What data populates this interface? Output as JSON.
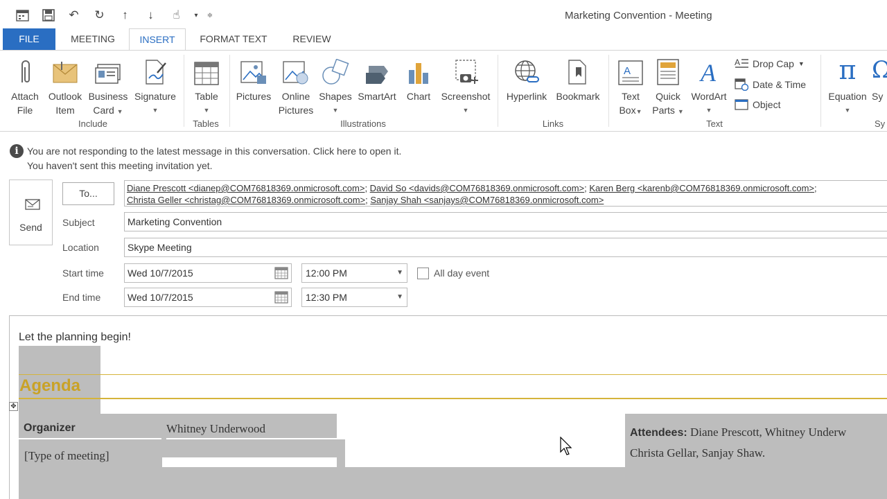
{
  "window": {
    "title": "Marketing Convention - Meeting"
  },
  "tabs": [
    {
      "label": "FILE"
    },
    {
      "label": "MEETING"
    },
    {
      "label": "INSERT"
    },
    {
      "label": "FORMAT TEXT"
    },
    {
      "label": "REVIEW"
    }
  ],
  "ribbon": {
    "attach_file": [
      "Attach",
      "File"
    ],
    "outlook_item": [
      "Outlook",
      "Item"
    ],
    "business_card": [
      "Business",
      "Card"
    ],
    "signature": "Signature",
    "table": "Table",
    "pictures": "Pictures",
    "online_pictures": [
      "Online",
      "Pictures"
    ],
    "shapes": "Shapes",
    "smartart": "SmartArt",
    "chart": "Chart",
    "screenshot": "Screenshot",
    "hyperlink": "Hyperlink",
    "bookmark": "Bookmark",
    "text_box": [
      "Text",
      "Box"
    ],
    "quick_parts": [
      "Quick",
      "Parts"
    ],
    "wordart": "WordArt",
    "drop_cap": "Drop Cap",
    "date_time": "Date & Time",
    "object": "Object",
    "equation": "Equation",
    "symbol_partial": "Sy",
    "groups": {
      "include": "Include",
      "tables": "Tables",
      "illustrations": "Illustrations",
      "links": "Links",
      "text": "Text",
      "symbols_partial": "Sy"
    }
  },
  "infobar": {
    "line1": "You are not responding to the latest message in this conversation. Click here to open it.",
    "line2": "You haven't sent this meeting invitation yet."
  },
  "form": {
    "send_label": "Send",
    "to_button": "To...",
    "recipients": [
      "Diane Prescott <dianep@COM76818369.onmicrosoft.com>",
      "David So <davids@COM76818369.onmicrosoft.com>",
      "Karen Berg <karenb@COM76818369.onmicrosoft.com>",
      "Christa Geller <christag@COM76818369.onmicrosoft.com>",
      "Sanjay Shah <sanjays@COM76818369.onmicrosoft.com>"
    ],
    "subject_label": "Subject",
    "subject_value": "Marketing Convention",
    "location_label": "Location",
    "location_value": "Skype Meeting",
    "start_label": "Start time",
    "start_date": "Wed 10/7/2015",
    "start_time": "12:00 PM",
    "allday_label": "All day event",
    "end_label": "End time",
    "end_date": "Wed 10/7/2015",
    "end_time": "12:30 PM"
  },
  "body": {
    "intro": "Let the planning begin!",
    "agenda_title": "Agenda",
    "organizer_label": "Organizer",
    "organizer_value": "Whitney Underwood",
    "meeting_type": "[Type of meeting]",
    "attendees_label": "Attendees:",
    "attendees_line1": "Diane Prescott, Whitney Underw",
    "attendees_line2": "Christa Gellar, Sanjay Shaw."
  },
  "colors": {
    "file_tab": "#2a6ec2",
    "accent_gold": "#c9a227",
    "placeholder_gray": "#bdbdbd"
  }
}
